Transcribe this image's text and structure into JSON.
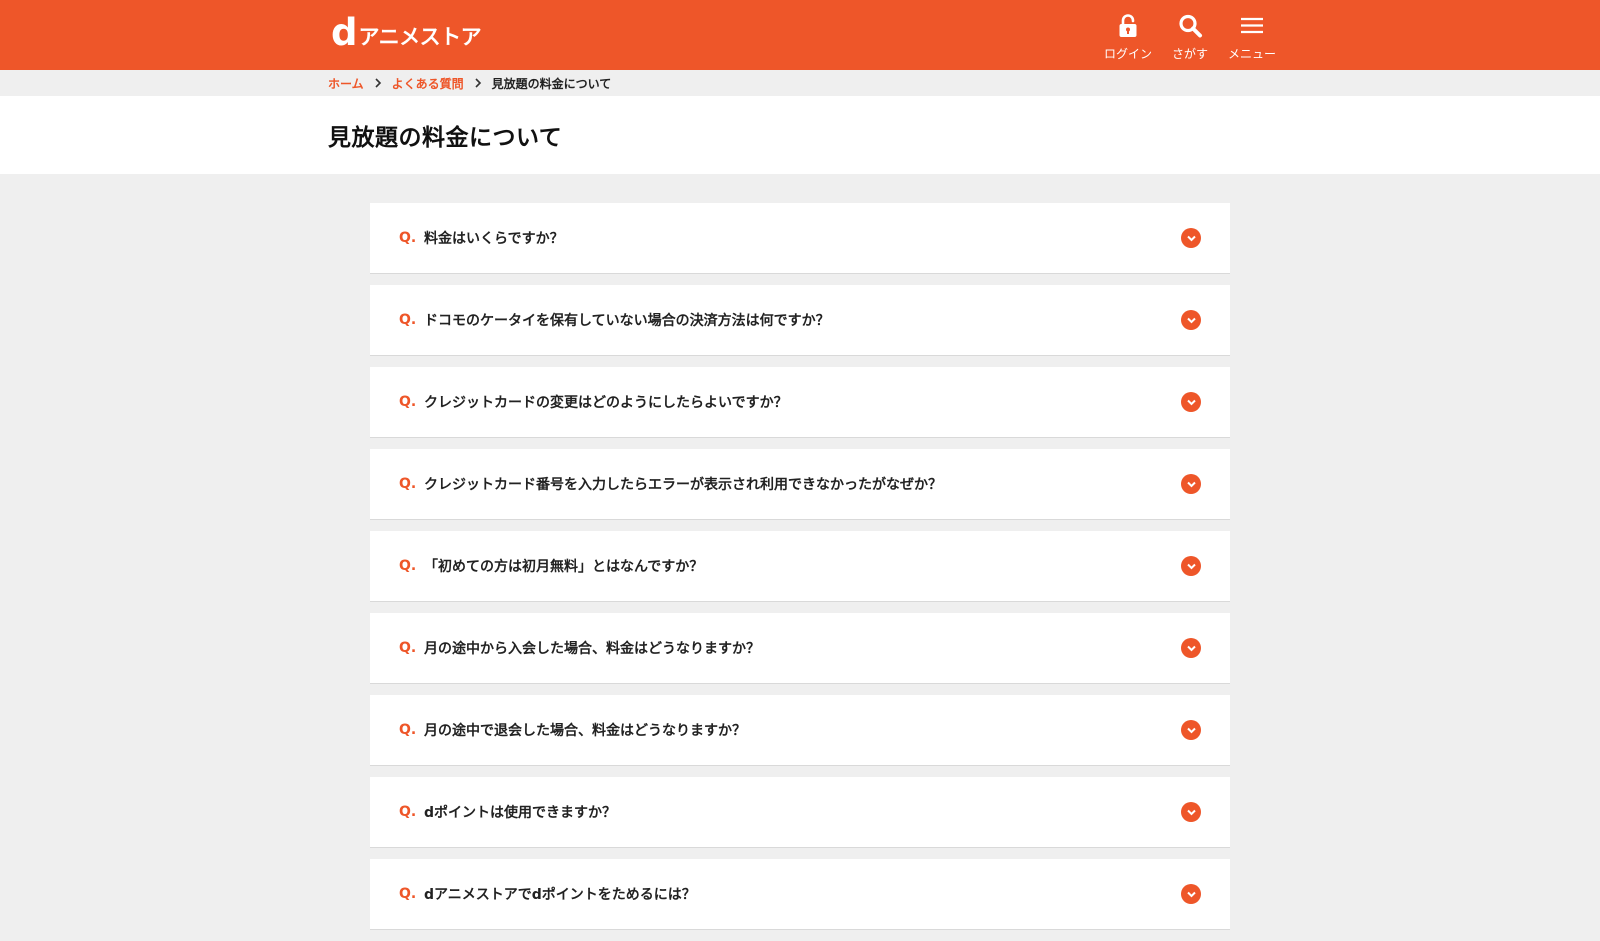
{
  "header": {
    "logo_d": "d",
    "logo_text": "アニメストア",
    "tools": [
      {
        "label": "ログイン",
        "icon": "lock-icon"
      },
      {
        "label": "さがす",
        "icon": "search-icon"
      },
      {
        "label": "メニュー",
        "icon": "menu-icon"
      }
    ]
  },
  "breadcrumb": {
    "home": "ホーム",
    "faq": "よくある質問",
    "current": "見放題の料金について"
  },
  "page": {
    "title": "見放題の料金について"
  },
  "faq": {
    "q_prefix": "Q.",
    "items": [
      "料金はいくらですか？",
      "ドコモのケータイを保有していない場合の決済方法は何ですか？",
      "クレジットカードの変更はどのようにしたらよいですか？",
      "クレジットカード番号を入力したらエラーが表示され利用できなかったがなぜか？",
      "「初めての方は初月無料」とはなんですか？",
      "月の途中から入会した場合、料金はどうなりますか？",
      "月の途中で退会した場合、料金はどうなりますか？",
      "dポイントは使用できますか？",
      "dアニメストアでdポイントをためるには？"
    ]
  },
  "colors": {
    "brand": "#ee5629",
    "background": "#efefef",
    "card": "#ffffff"
  }
}
